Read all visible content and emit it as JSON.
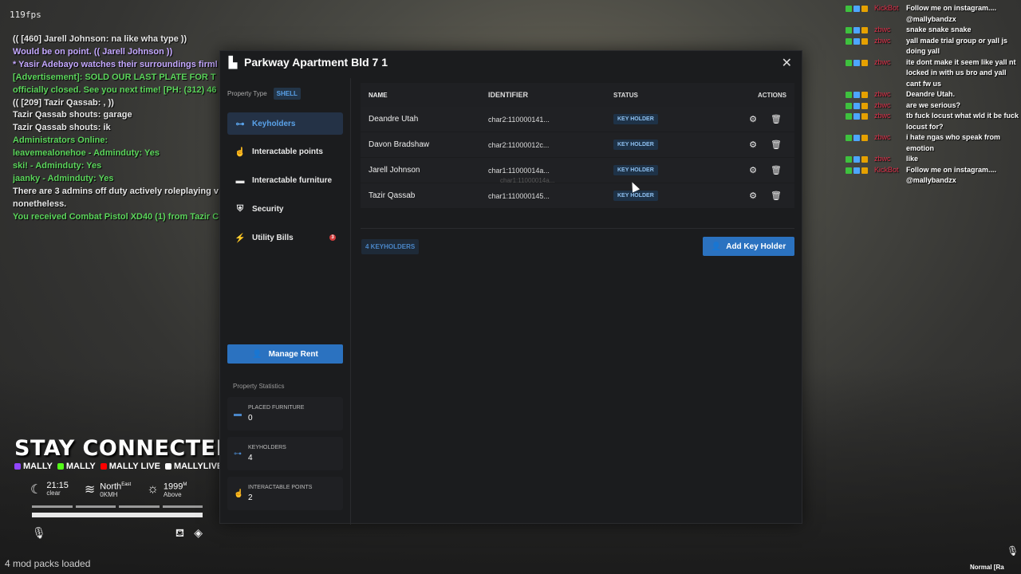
{
  "hud": {
    "fps": "119fps",
    "chat": [
      {
        "text": "(( [460] Jarell Johnson: na like wha type ))",
        "color": "white"
      },
      {
        "text": "Would be on point. (( Jarell Johnson ))",
        "color": "purple"
      },
      {
        "text": "* Yasir Adebayo watches their surroundings firml",
        "color": "purple"
      },
      {
        "text": "[Advertisement]: SOLD OUR LAST PLATE FOR T",
        "color": "green"
      },
      {
        "text": "officially closed. See you next time! [PH: (312) 46",
        "color": "green"
      },
      {
        "text": "(( [209] Tazir Qassab: , ))",
        "color": "white"
      },
      {
        "text": "Tazir Qassab shouts: garage",
        "color": "white"
      },
      {
        "text": "Tazir Qassab shouts: ik",
        "color": "white"
      },
      {
        "text": "Administrators Online:",
        "color": "green"
      },
      {
        "text": "leavemealonehoe - Adminduty: Yes",
        "color": "green"
      },
      {
        "text": "ski! - Adminduty: Yes",
        "color": "green"
      },
      {
        "text": "jaanky - Adminduty: Yes",
        "color": "green"
      },
      {
        "text": "There are 3 admins off duty actively roleplaying v",
        "color": "white"
      },
      {
        "text": "nonetheless.",
        "color": "white"
      },
      {
        "text": "You received Combat Pistol XD40 (1) from Tazir C",
        "color": "green"
      }
    ],
    "stay_connected": "STAY CONNECTED",
    "socials": [
      {
        "label": "MALLY",
        "color": "#9146ff"
      },
      {
        "label": "MALLY",
        "color": "#53fc18"
      },
      {
        "label": "MALLY LIVE",
        "color": "#ff0000"
      },
      {
        "label": "MALLYLIVEE",
        "color": "#ffffff"
      }
    ],
    "weather": [
      {
        "icon": "moon-icon",
        "glyph": "☾",
        "main": "21:15",
        "sub": "clear"
      },
      {
        "icon": "wind-icon",
        "glyph": "≋",
        "main": "North",
        "sup": "East",
        "sub": "0KMH"
      },
      {
        "icon": "sunrise-icon",
        "glyph": "☼",
        "main": "1999",
        "sup": "M",
        "sub": "Above"
      }
    ],
    "mods_loaded": "4 mod packs loaded",
    "voice_mode": "Normal [Ra"
  },
  "twitch": [
    {
      "user": "KickBot",
      "msg": "Follow me on instagram.... @mallybandzx"
    },
    {
      "user": "zbwc",
      "msg": "snake snake snake"
    },
    {
      "user": "zbwc",
      "msg": "yall made trial group or yall js doing yall"
    },
    {
      "user": "zbwc",
      "msg": "ite dont make it seem like yall nt locked in with us bro and yall cant fw us"
    },
    {
      "user": "zbwc",
      "msg": "Deandre Utah."
    },
    {
      "user": "zbwc",
      "msg": "are we serious?"
    },
    {
      "user": "zbwc",
      "msg": "tb fuck locust what wld it be fuck locust for?"
    },
    {
      "user": "zbwc",
      "msg": "i hate ngas who speak from emotion"
    },
    {
      "user": "zbwc",
      "msg": "like"
    },
    {
      "user": "KickBot",
      "msg": "Follow me on instagram.... @mallybandzx"
    }
  ],
  "modal": {
    "title": "Parkway Apartment Bld 7 1",
    "property_type_label": "Property Type",
    "property_type_value": "SHELL",
    "nav": [
      {
        "label": "Keyholders",
        "icon": "key-icon",
        "glyph": "⊶",
        "active": true
      },
      {
        "label": "Interactable points",
        "icon": "hand-pointer-icon",
        "glyph": "☝",
        "active": false
      },
      {
        "label": "Interactable furniture",
        "icon": "couch-icon",
        "glyph": "▬",
        "active": false
      },
      {
        "label": "Security",
        "icon": "shield-icon",
        "glyph": "⛨",
        "active": false
      },
      {
        "label": "Utility Bills",
        "icon": "bolt-icon",
        "glyph": "⚡",
        "active": false,
        "badge": "3"
      }
    ],
    "manage_rent": "Manage Rent",
    "stats_title": "Property Statistics",
    "stats": [
      {
        "label": "PLACED FURNITURE",
        "value": "0",
        "icon": "couch-icon"
      },
      {
        "label": "KEYHOLDERS",
        "value": "4",
        "icon": "key-icon"
      },
      {
        "label": "INTERACTABLE POINTS",
        "value": "2",
        "icon": "hand-pointer-icon"
      }
    ],
    "table": {
      "headers": {
        "name": "NAME",
        "identifier": "IDENTIFIER",
        "status": "STATUS",
        "actions": "ACTIONS"
      },
      "rows": [
        {
          "name": "Deandre Utah",
          "identifier": "char2:110000141...",
          "status": "KEY HOLDER"
        },
        {
          "name": "Davon Bradshaw",
          "identifier": "char2:11000012c...",
          "status": "KEY HOLDER"
        },
        {
          "name": "Jarell Johnson",
          "identifier": "char1:11000014a...",
          "status": "KEY HOLDER"
        },
        {
          "name": "Tazir Qassab",
          "identifier": "char1:110000145...",
          "status": "KEY HOLDER"
        }
      ],
      "tooltip": "char1:11000014a..."
    },
    "keyholder_count": "4 KEYHOLDERS",
    "add_key_holder": "Add Key Holder"
  }
}
